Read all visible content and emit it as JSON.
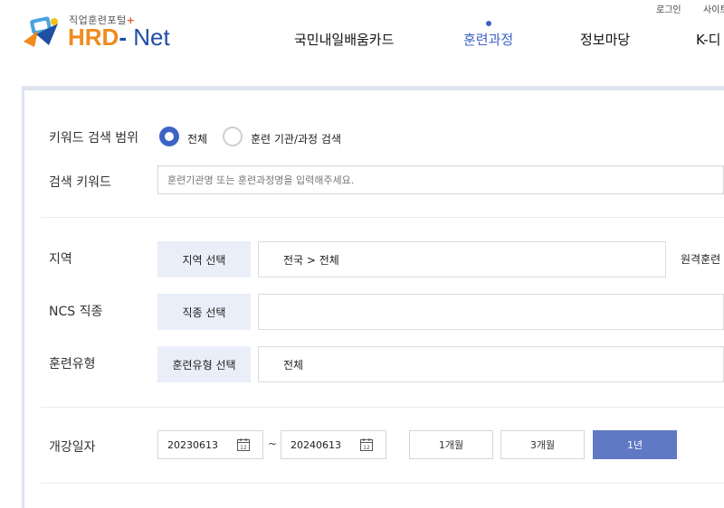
{
  "header": {
    "logo": {
      "sub": "직업훈련포털",
      "plus": "+",
      "hrd": "HRD",
      "dash": "-",
      "net": " Net"
    },
    "util": {
      "login": "로그인",
      "sitemap": "사이트"
    },
    "nav": [
      {
        "label": "국민내일배움카드",
        "active": false
      },
      {
        "label": "훈련과정",
        "active": true
      },
      {
        "label": "정보마당",
        "active": false
      },
      {
        "label": "K-디",
        "active": false
      }
    ]
  },
  "search": {
    "scope_label": "키워드 검색 범위",
    "scope_options": [
      {
        "label": "전체",
        "selected": true
      },
      {
        "label": "훈련 기관/과정 검색",
        "selected": false
      }
    ],
    "keyword_label": "검색 키워드",
    "keyword_placeholder": "훈련기관명 또는 훈련과정명을 입력해주세요.",
    "keyword_value": "",
    "region": {
      "label": "지역",
      "button": "지역 선택",
      "value": "전국 > 전체",
      "remote": "원격훈련"
    },
    "ncs": {
      "label": "NCS 직종",
      "button": "직종 선택",
      "value": ""
    },
    "type": {
      "label": "훈련유형",
      "button": "훈련유형 선택",
      "value": "전체"
    },
    "date": {
      "label": "개강일자",
      "start": "20230613",
      "separator": "~",
      "end": "20240613",
      "periods": [
        {
          "label": "1개월",
          "selected": false
        },
        {
          "label": "3개월",
          "selected": false
        },
        {
          "label": "1년",
          "selected": true
        }
      ]
    }
  },
  "colors": {
    "accent": "#3e63c6",
    "button_bg": "#e9eef8",
    "period_selected": "#6079c4",
    "logo_orange": "#f28a1e",
    "logo_blue": "#1f4fa3"
  }
}
